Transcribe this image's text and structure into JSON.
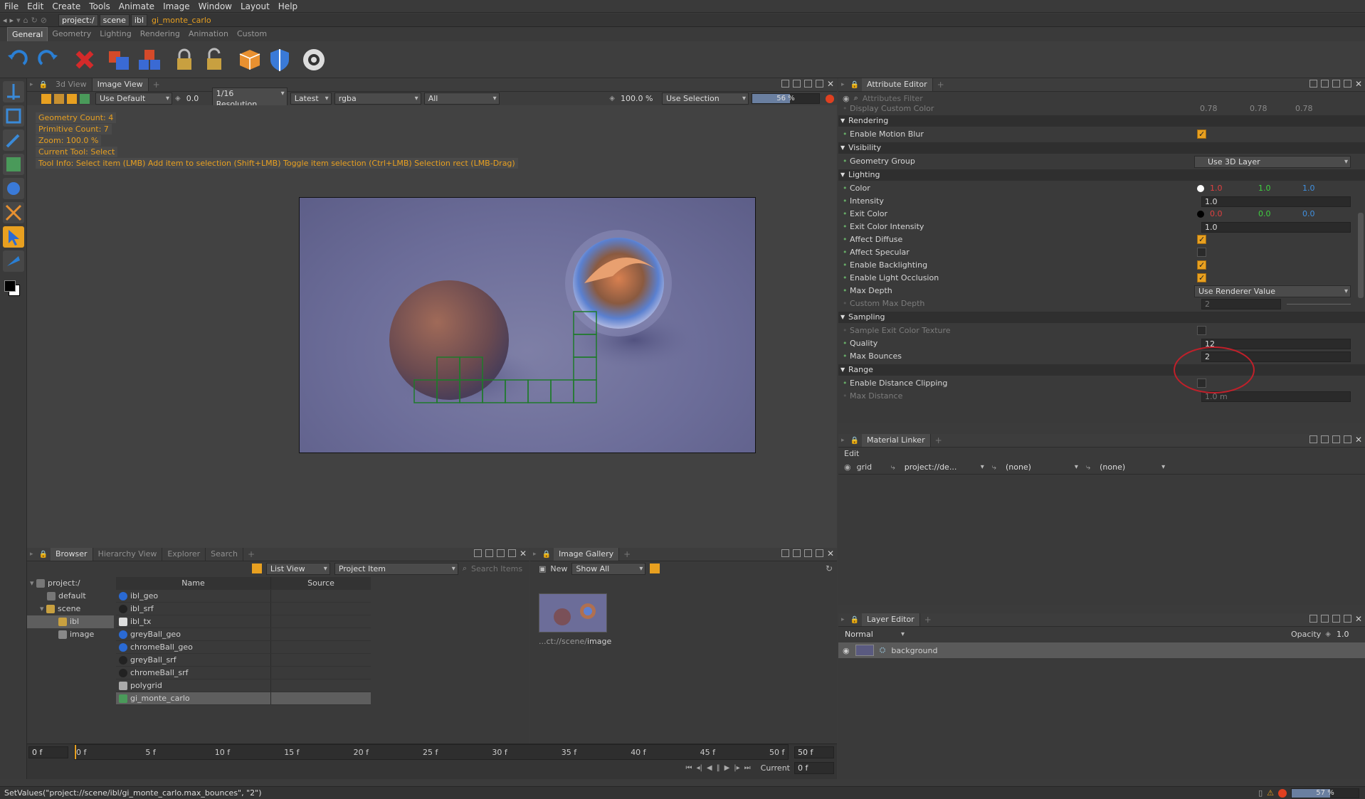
{
  "menu": [
    "File",
    "Edit",
    "Create",
    "Tools",
    "Animate",
    "Image",
    "Window",
    "Layout",
    "Help"
  ],
  "path": {
    "crumbs": [
      "project:/",
      "scene",
      "ibl",
      "gi_monte_carlo"
    ]
  },
  "shelf_tabs": [
    "General",
    "Geometry",
    "Lighting",
    "Rendering",
    "Animation",
    "Custom"
  ],
  "shelf_tools": [
    {
      "icon": "undo-icon",
      "color": "#2a7fd4"
    },
    {
      "icon": "redo-icon",
      "color": "#2a7fd4"
    },
    {
      "icon": "delete-icon",
      "color": "#d42a2a"
    },
    {
      "icon": "duplicate-icon",
      "color": "#d44a2a"
    },
    {
      "icon": "instance-icon",
      "color": "#3a6ad4"
    },
    {
      "icon": "lock-icon",
      "color": "#c8a040"
    },
    {
      "icon": "unlock-icon",
      "color": "#c8a040"
    },
    {
      "icon": "cube-icon",
      "color": "#e89030"
    },
    {
      "icon": "shield-icon",
      "color": "#3a7ad8"
    },
    {
      "icon": "render-icon",
      "color": "#dddddd"
    }
  ],
  "viewer": {
    "tabs": [
      "3d View",
      "Image View"
    ],
    "toolbar": {
      "display": "Use Default",
      "exposure": "0.0",
      "resolution": "1/16 Resolution",
      "version": "Latest",
      "channels": "rgba",
      "layer": "All",
      "zoom": "100.0 %",
      "selection": "Use Selection",
      "progress": "56 %",
      "progress_frac": 0.56
    },
    "overlay": [
      "Geometry Count: 4",
      "Primitive Count: 7",
      "Zoom: 100.0 %",
      "Current Tool: Select"
    ],
    "toolinfo": "Tool Info: Select item (LMB)  Add item to selection (Shift+LMB)  Toggle item selection (Ctrl+LMB)  Selection rect (LMB-Drag)"
  },
  "attr": {
    "tab": "Attribute Editor",
    "filter_placeholder": "Attributes Filter",
    "top_label": "Display Custom Color",
    "top_vals": [
      "0.78",
      "0.78",
      "0.78"
    ],
    "rendering": {
      "title": "Rendering",
      "motion_blur": "Enable Motion Blur"
    },
    "visibility": {
      "title": "Visibility",
      "geo_group": "Geometry Group",
      "geo_group_val": "Use 3D Layer"
    },
    "lighting": {
      "title": "Lighting",
      "color": "Color",
      "color_vals": [
        "1.0",
        "1.0",
        "1.0"
      ],
      "intensity": "Intensity",
      "intensity_val": "1.0",
      "exit_color": "Exit Color",
      "exit_vals": [
        "0.0",
        "0.0",
        "0.0"
      ],
      "exit_int": "Exit Color Intensity",
      "exit_int_val": "1.0",
      "diffuse": "Affect Diffuse",
      "specular": "Affect Specular",
      "backlight": "Enable Backlighting",
      "occlusion": "Enable Light Occlusion",
      "max_depth": "Max Depth",
      "max_depth_val": "Use Renderer Value",
      "custom_depth": "Custom Max Depth",
      "custom_depth_val": "2"
    },
    "sampling": {
      "title": "Sampling",
      "sample_exit": "Sample Exit Color Texture",
      "quality": "Quality",
      "quality_val": "12",
      "bounces": "Max Bounces",
      "bounces_val": "2"
    },
    "range": {
      "title": "Range",
      "clip": "Enable Distance Clipping",
      "max_dist": "Max Distance",
      "max_dist_val": "1.0 m"
    }
  },
  "material": {
    "tab": "Material Linker",
    "edit": "Edit",
    "row": [
      "grid",
      "project://de...",
      "(none)",
      "(none)"
    ]
  },
  "layers": {
    "tab": "Layer Editor",
    "mode": "Normal",
    "opacity_label": "Opacity",
    "opacity": "1.0",
    "items": [
      "background"
    ]
  },
  "browser": {
    "tabs": [
      "Browser",
      "Hierarchy View",
      "Explorer",
      "Search"
    ],
    "view": "List View",
    "filter": "Project Item",
    "search_placeholder": "Search Items",
    "tree": [
      "project:/",
      "default",
      "scene",
      "ibl",
      "image"
    ],
    "cols": [
      "Name",
      "Source"
    ],
    "items": [
      {
        "name": "ibl_geo",
        "icon": "sphere-icon"
      },
      {
        "name": "ibl_srf",
        "icon": "surface-icon"
      },
      {
        "name": "ibl_tx",
        "icon": "texture-icon"
      },
      {
        "name": "greyBall_geo",
        "icon": "sphere-icon"
      },
      {
        "name": "chromeBall_geo",
        "icon": "sphere-icon"
      },
      {
        "name": "greyBall_srf",
        "icon": "surface-icon"
      },
      {
        "name": "chromeBall_srf",
        "icon": "surface-icon"
      },
      {
        "name": "polygrid",
        "icon": "grid-icon"
      },
      {
        "name": "gi_monte_carlo",
        "icon": "light-icon"
      }
    ]
  },
  "gallery": {
    "tab": "Image Gallery",
    "new": "New",
    "filter": "Show All",
    "caption_pre": "...ct://scene/",
    "caption": "image"
  },
  "timeline": {
    "start": "0 f",
    "ticks": [
      "0 f",
      "5 f",
      "10 f",
      "15 f",
      "20 f",
      "25 f",
      "30 f",
      "35 f",
      "40 f",
      "45 f",
      "50 f"
    ],
    "end": "50 f",
    "current_label": "Current",
    "current": "0 f"
  },
  "status": {
    "text": "SetValues(\"project://scene/ibl/gi_monte_carlo.max_bounces\", \"2\")",
    "progress": "57 %"
  }
}
